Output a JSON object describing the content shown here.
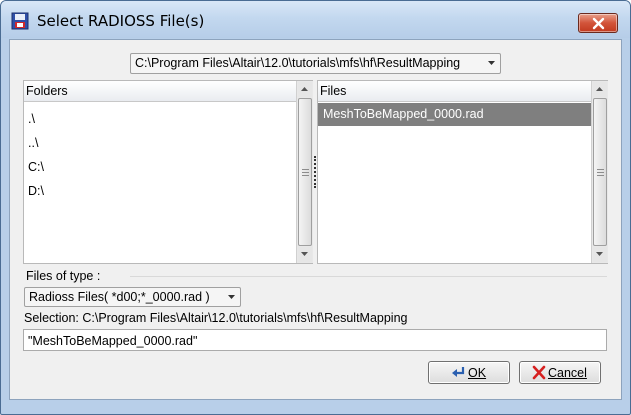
{
  "window": {
    "title": "Select RADIOSS File(s)",
    "icon": "radioss-disk-icon",
    "close_icon": "close-icon"
  },
  "path": {
    "value": "C:\\Program Files\\Altair\\12.0\\tutorials\\mfs\\hf\\ResultMapping"
  },
  "folders": {
    "header": "Folders",
    "items": [
      ".\\",
      "..\\",
      "C:\\",
      "D:\\"
    ]
  },
  "files": {
    "header": "Files",
    "items": [
      "MeshToBeMapped_0000.rad"
    ],
    "selected_index": 0
  },
  "file_type": {
    "label": "Files of type :",
    "value": "Radioss Files( *d00;*_0000.rad )"
  },
  "selection": {
    "label": "Selection: C:\\Program Files\\Altair\\12.0\\tutorials\\mfs\\hf\\ResultMapping",
    "value": "\"MeshToBeMapped_0000.rad\""
  },
  "buttons": {
    "ok_label": "OK",
    "cancel_label": "Cancel"
  },
  "colors": {
    "selected_row": "#7f7f7f",
    "close_button": "#d2543a"
  }
}
